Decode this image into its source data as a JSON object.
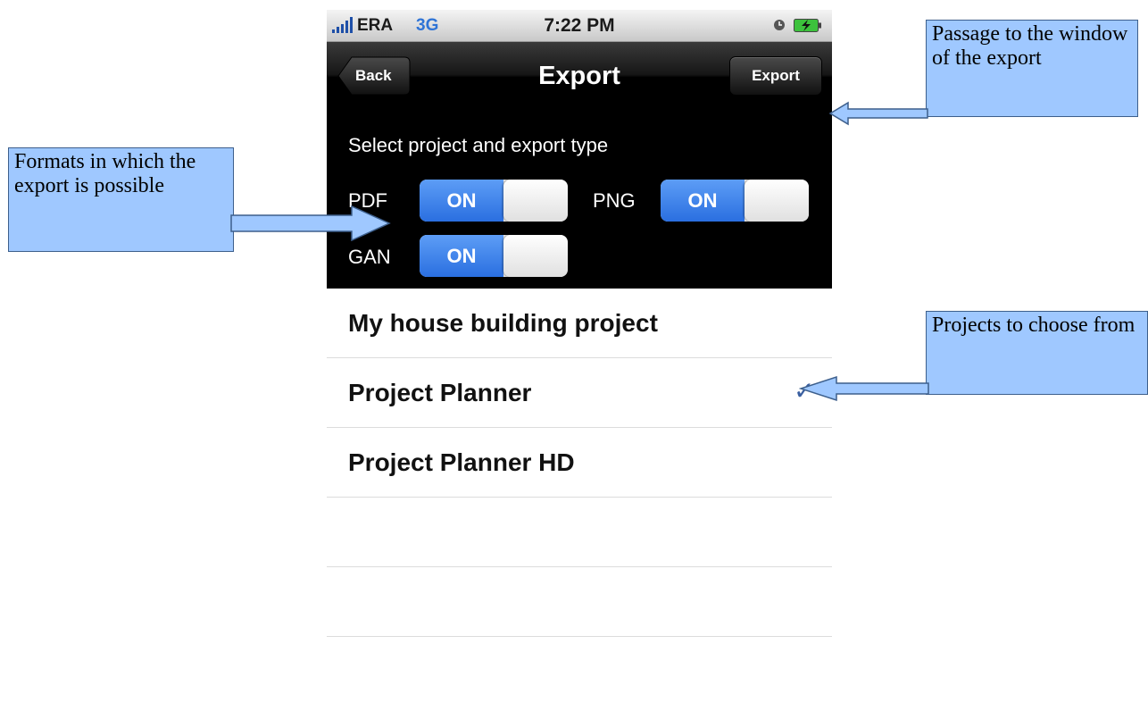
{
  "status_bar": {
    "carrier": "ERA",
    "network": "3G",
    "time": "7:22 PM"
  },
  "nav": {
    "back_label": "Back",
    "title": "Export",
    "export_label": "Export"
  },
  "options": {
    "heading": "Select project and export type",
    "formats": [
      {
        "label": "PDF",
        "toggle": "ON"
      },
      {
        "label": "PNG",
        "toggle": "ON"
      },
      {
        "label": "GAN",
        "toggle": "ON"
      }
    ]
  },
  "projects": [
    {
      "name": "My house building project",
      "selected": false
    },
    {
      "name": "Project Planner",
      "selected": true
    },
    {
      "name": "Project Planner HD",
      "selected": false
    }
  ],
  "annotations": {
    "export_window": "Passage to the window of the export",
    "formats": "Formats in which the export is possible",
    "projects": "Projects to choose from"
  },
  "colors": {
    "toggle_on": "#2f74e6",
    "callout_fill": "#9fc8ff",
    "checkmark": "#3a5fa0",
    "network": "#2f74d6"
  }
}
